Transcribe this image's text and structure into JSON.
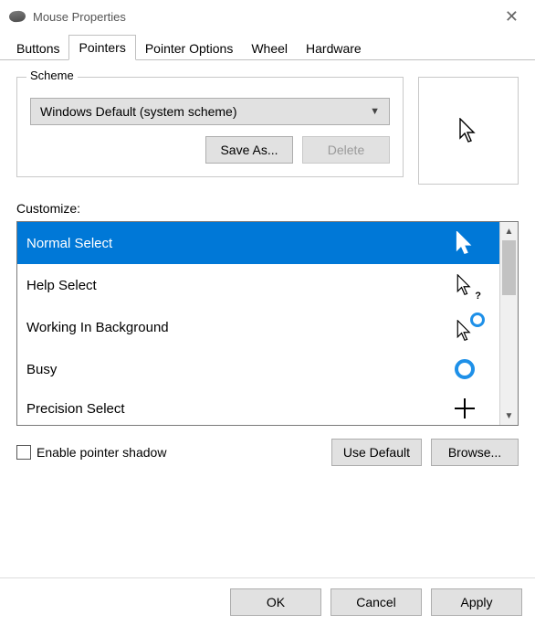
{
  "window": {
    "title": "Mouse Properties",
    "tabs": [
      "Buttons",
      "Pointers",
      "Pointer Options",
      "Wheel",
      "Hardware"
    ],
    "active_tab": "Pointers"
  },
  "scheme": {
    "legend": "Scheme",
    "selected": "Windows Default (system scheme)",
    "save_as": "Save As...",
    "delete": "Delete"
  },
  "customize_label": "Customize:",
  "cursors": [
    {
      "name": "Normal Select",
      "icon": "arrow",
      "selected": true
    },
    {
      "name": "Help Select",
      "icon": "arrow-help",
      "selected": false
    },
    {
      "name": "Working In Background",
      "icon": "arrow-ring",
      "selected": false
    },
    {
      "name": "Busy",
      "icon": "ring",
      "selected": false
    },
    {
      "name": "Precision Select",
      "icon": "cross",
      "selected": false
    }
  ],
  "enable_shadow": {
    "label": "Enable pointer shadow",
    "checked": false
  },
  "actions": {
    "use_default": "Use Default",
    "browse": "Browse..."
  },
  "footer": {
    "ok": "OK",
    "cancel": "Cancel",
    "apply": "Apply"
  }
}
